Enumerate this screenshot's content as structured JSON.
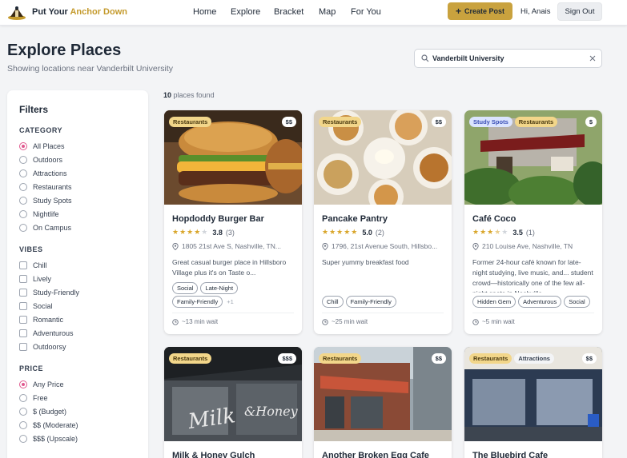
{
  "header": {
    "brand_prefix": "Put Your ",
    "brand_accent": "Anchor Down",
    "nav": [
      "Home",
      "Explore",
      "Bracket",
      "Map",
      "For You"
    ],
    "create_label": "Create Post",
    "greeting": "Hi, Anais",
    "signout_label": "Sign Out"
  },
  "page": {
    "title": "Explore Places",
    "subtitle": "Showing locations near Vanderbilt University"
  },
  "search": {
    "value": "Vanderbilt University"
  },
  "filters": {
    "title": "Filters",
    "category_title": "CATEGORY",
    "categories": [
      "All Places",
      "Outdoors",
      "Attractions",
      "Restaurants",
      "Study Spots",
      "Nightlife",
      "On Campus"
    ],
    "category_selected": "All Places",
    "vibes_title": "VIBES",
    "vibes": [
      "Chill",
      "Lively",
      "Study-Friendly",
      "Social",
      "Romantic",
      "Adventurous",
      "Outdoorsy"
    ],
    "price_title": "PRICE",
    "prices": [
      "Any Price",
      "Free",
      "$ (Budget)",
      "$$ (Moderate)",
      "$$$ (Upscale)"
    ],
    "price_selected": "Any Price"
  },
  "results": {
    "count": "10",
    "count_suffix": "places found"
  },
  "cards": [
    {
      "name": "Hopdoddy Burger Bar",
      "categories": [
        "Restaurants"
      ],
      "price": "$$",
      "rating": "3.8",
      "rating_count": "(3)",
      "stars_filled": 4,
      "address": "1805 21st Ave S, Nashville, TN...",
      "description": "Great casual burger place in Hillsboro Village plus it's on Taste o...",
      "tags": [
        "Social",
        "Late-Night",
        "Family-Friendly"
      ],
      "more": "+1",
      "wait": "~13 min wait",
      "image": "burger"
    },
    {
      "name": "Pancake Pantry",
      "categories": [
        "Restaurants"
      ],
      "price": "$$",
      "rating": "5.0",
      "rating_count": "(2)",
      "stars_filled": 5,
      "address": "1796, 21st Avenue South, Hillsbo...",
      "description": "Super yummy breakfast food",
      "tags": [
        "Chill",
        "Family-Friendly"
      ],
      "more": "",
      "wait": "~25 min wait",
      "image": "pancake"
    },
    {
      "name": "Café Coco",
      "categories": [
        "Study Spots",
        "Restaurants"
      ],
      "price": "$",
      "rating": "3.5",
      "rating_count": "(1)",
      "stars_filled": 3.5,
      "address": "210 Louise Ave, Nashville, TN",
      "description": "Former 24-hour café known for late-night studying, live music, and... student crowd—historically one of the few all-night spots in Nashville",
      "tags": [
        "Hidden Gem",
        "Adventurous",
        "Social"
      ],
      "more": "",
      "wait": "~5 min wait",
      "image": "cafe"
    },
    {
      "name": "Milk & Honey Gulch",
      "categories": [
        "Restaurants"
      ],
      "price": "$$$",
      "image": "milkhoney"
    },
    {
      "name": "Another Broken Egg Cafe",
      "categories": [
        "Restaurants"
      ],
      "price": "$$",
      "image": "brokenegg"
    },
    {
      "name": "The Bluebird Cafe",
      "categories": [
        "Restaurants",
        "Attractions"
      ],
      "price": "$$",
      "image": "bluebird"
    }
  ],
  "colors": {
    "accent": "#c9a23e",
    "radio_selected": "#e0588e",
    "star": "#d9a62b"
  }
}
